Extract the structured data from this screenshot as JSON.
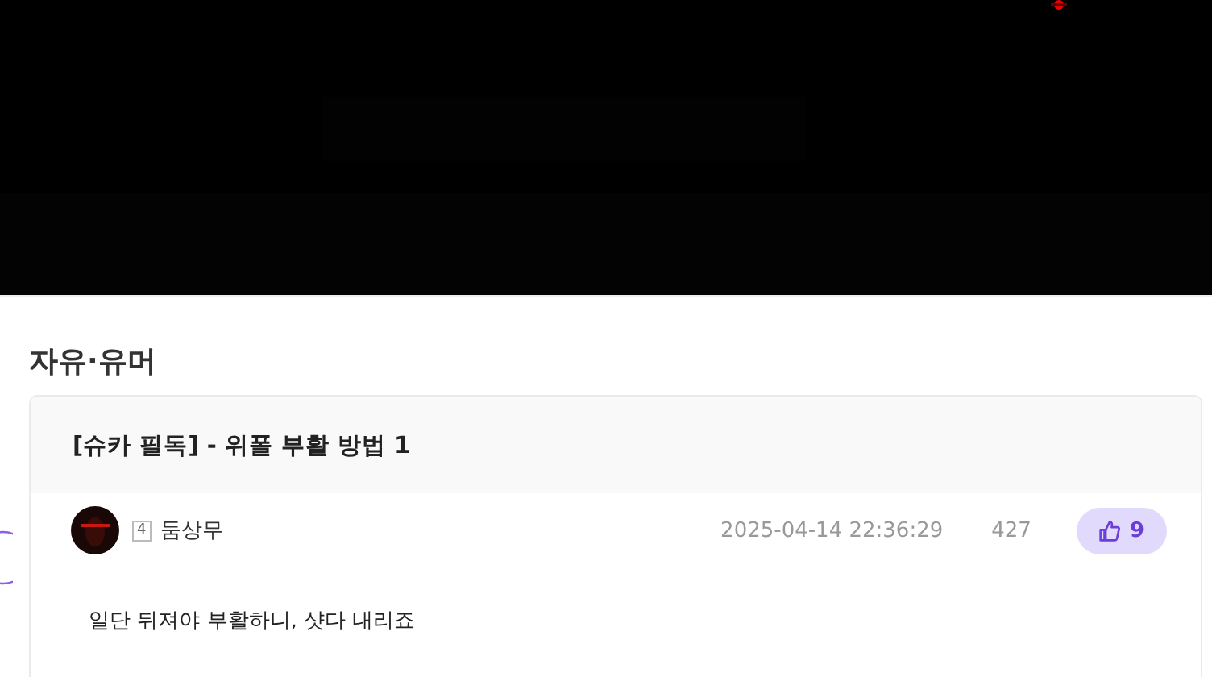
{
  "board": {
    "title": "자유·유머"
  },
  "post": {
    "title": "[슈카 필독] - 위폴 부활 방법 1",
    "author": {
      "level": "4",
      "name": "둠상무"
    },
    "date": "2025-04-14 22:36:29",
    "views": "427",
    "likes": "9",
    "body": "일단 뒤져야 부활하니, 샷다 내리죠"
  }
}
